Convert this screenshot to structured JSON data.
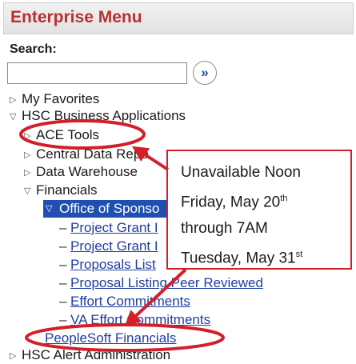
{
  "header": {
    "title": "Enterprise Menu"
  },
  "search": {
    "label": "Search:",
    "placeholder": "",
    "go_button": "»"
  },
  "menu": {
    "my_favorites": "My Favorites",
    "hsc_business_applications": "HSC Business Applications",
    "ace_tools": "ACE Tools",
    "central_data_reports": "Central Data Repo",
    "data_warehouse": "Data Warehouse",
    "financials": "Financials",
    "office_of_sponsored": "Office of Sponso",
    "links": [
      "Project Grant I",
      "Project Grant I",
      "Proposals List",
      "Proposal Listing Peer Reviewed",
      "Effort Commitments",
      "VA Effort Commitments"
    ],
    "peoplesoft_financials": "PeopleSoft Financials",
    "hsc_alert_administration": "HSC Alert Administration"
  },
  "callout": {
    "line1": "Unavailable Noon",
    "line2_text": "Friday,  May 20",
    "line2_sup": "th",
    "line3": "through 7AM",
    "line4_text": "Tuesday, May 31",
    "line4_sup": "st"
  },
  "colors": {
    "title_red": "#b8312f",
    "link_blue": "#1f3ea0",
    "highlight_blue": "#1f4fb0",
    "annotation_red": "#d21f2a"
  }
}
